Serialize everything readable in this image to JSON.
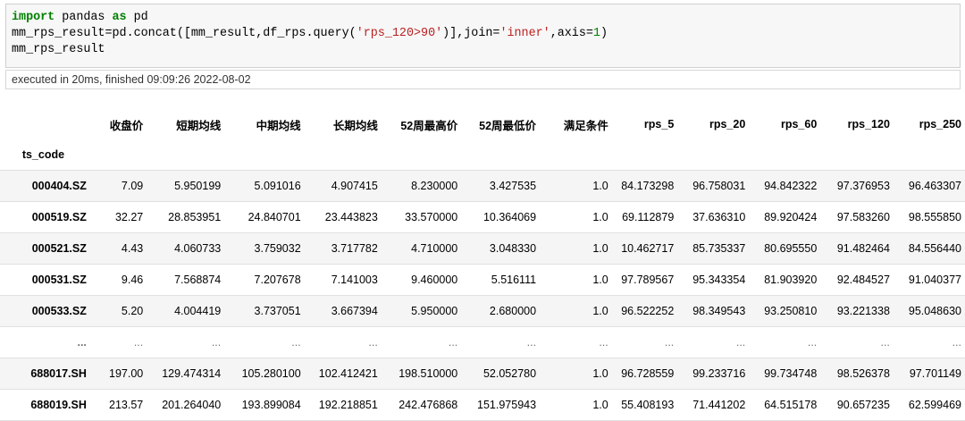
{
  "code": {
    "lines": [
      {
        "parts": [
          {
            "t": "import",
            "c": "kw"
          },
          {
            "t": " pandas ",
            "c": ""
          },
          {
            "t": "as",
            "c": "kw"
          },
          {
            "t": " pd",
            "c": ""
          }
        ]
      },
      {
        "parts": [
          {
            "t": "mm_rps_result=pd.concat([mm_result,df_rps.query(",
            "c": ""
          },
          {
            "t": "'rps_120>90'",
            "c": "str"
          },
          {
            "t": ")],join=",
            "c": ""
          },
          {
            "t": "'inner'",
            "c": "str"
          },
          {
            "t": ",axis=",
            "c": ""
          },
          {
            "t": "1",
            "c": "num"
          },
          {
            "t": ")",
            "c": ""
          }
        ]
      },
      {
        "parts": [
          {
            "t": "mm_rps_result",
            "c": ""
          }
        ]
      }
    ]
  },
  "exec_status": "executed in 20ms, finished 09:09:26 2022-08-02",
  "table": {
    "index_name": "ts_code",
    "columns": [
      "收盘价",
      "短期均线",
      "中期均线",
      "长期均线",
      "52周最高价",
      "52周最低价",
      "满足条件",
      "rps_5",
      "rps_20",
      "rps_60",
      "rps_120",
      "rps_250"
    ],
    "col_widths": [
      52,
      87,
      90,
      86,
      90,
      88,
      83,
      72,
      80,
      80,
      82,
      80
    ],
    "rows": [
      {
        "index": "000404.SZ",
        "values": [
          "7.09",
          "5.950199",
          "5.091016",
          "4.907415",
          "8.230000",
          "3.427535",
          "1.0",
          "84.173298",
          "96.758031",
          "94.842322",
          "97.376953",
          "96.463307"
        ]
      },
      {
        "index": "000519.SZ",
        "values": [
          "32.27",
          "28.853951",
          "24.840701",
          "23.443823",
          "33.570000",
          "10.364069",
          "1.0",
          "69.112879",
          "37.636310",
          "89.920424",
          "97.583260",
          "98.555850"
        ]
      },
      {
        "index": "000521.SZ",
        "values": [
          "4.43",
          "4.060733",
          "3.759032",
          "3.717782",
          "4.710000",
          "3.048330",
          "1.0",
          "10.462717",
          "85.735337",
          "80.695550",
          "91.482464",
          "84.556440"
        ]
      },
      {
        "index": "000531.SZ",
        "values": [
          "9.46",
          "7.568874",
          "7.207678",
          "7.141003",
          "9.460000",
          "5.516111",
          "1.0",
          "97.789567",
          "95.343354",
          "81.903920",
          "92.484527",
          "91.040377"
        ]
      },
      {
        "index": "000533.SZ",
        "values": [
          "5.20",
          "4.004419",
          "3.737051",
          "3.667394",
          "5.950000",
          "2.680000",
          "1.0",
          "96.522252",
          "98.349543",
          "93.250810",
          "93.221338",
          "95.048630"
        ]
      },
      {
        "index": "...",
        "values": [
          "...",
          "...",
          "...",
          "...",
          "...",
          "...",
          "...",
          "...",
          "...",
          "...",
          "...",
          "..."
        ]
      },
      {
        "index": "688017.SH",
        "values": [
          "197.00",
          "129.474314",
          "105.280100",
          "102.412421",
          "198.510000",
          "52.052780",
          "1.0",
          "96.728559",
          "99.233716",
          "99.734748",
          "98.526378",
          "97.701149"
        ]
      },
      {
        "index": "688019.SH",
        "values": [
          "213.57",
          "201.264040",
          "193.899084",
          "192.218851",
          "242.476868",
          "151.975943",
          "1.0",
          "55.408193",
          "71.441202",
          "64.515178",
          "90.657235",
          "62.599469"
        ]
      }
    ]
  }
}
